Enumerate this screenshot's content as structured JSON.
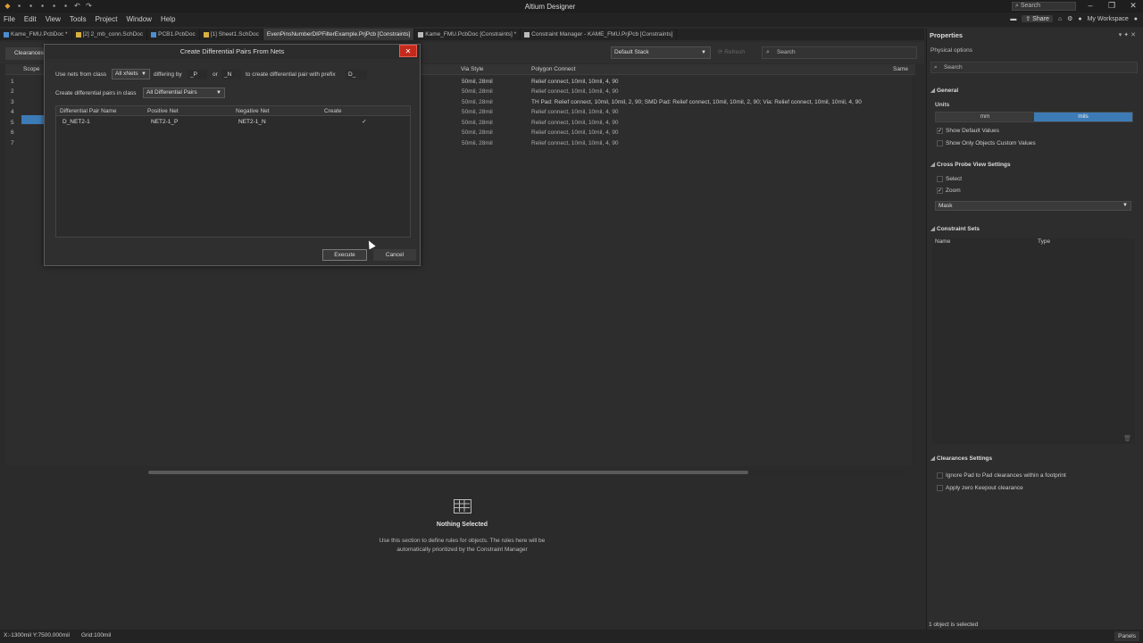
{
  "app": {
    "title": "Altium Designer"
  },
  "titlebar": {
    "search_placeholder": "Search"
  },
  "menu": {
    "items": [
      "File",
      "Edit",
      "View",
      "Tools",
      "Project",
      "Window",
      "Help"
    ],
    "share_label": "Share",
    "workspace_label": "My Workspace"
  },
  "tabs": [
    {
      "label": "Kame_FMU.PcbDoc *"
    },
    {
      "label": "[2] 2_mb_conn.SchDoc"
    },
    {
      "label": "PCB1.PcbDoc"
    },
    {
      "label": "[1] Sheet1.SchDoc"
    },
    {
      "label": "EvenPinsNumberDIPFilterExample.PrjPcb [Constraints]"
    },
    {
      "label": "Kame_FMU.PcbDoc [Constraints] *"
    },
    {
      "label": "Constraint Manager - KAME_FMU.PrjPcb [Constraints]"
    }
  ],
  "toolbar": {
    "clearance_tab": "Clearances",
    "stack_value": "Default Stack",
    "refresh_label": "Refresh",
    "search_placeholder": "Search"
  },
  "grid": {
    "headers": {
      "scope": "Scope",
      "via_style": "Via Style",
      "polygon_connect": "Polygon Connect",
      "same": "Same"
    },
    "row_numbers": [
      "1",
      "2",
      "3",
      "4",
      "5",
      "6",
      "7"
    ],
    "rows": [
      {
        "via": "50mil, 28mil",
        "polygon": "Relief connect, 10mil, 10mil, 4, 90"
      },
      {
        "via": "50mil, 28mil",
        "polygon": "Relief connect, 10mil, 10mil, 4, 90"
      },
      {
        "via": "50mil, 28mil",
        "polygon": "TH Pad: Relief connect, 10mil, 10mil, 2, 90; SMD Pad: Relief connect, 10mil, 10mil, 2, 90; Via: Relief connect, 10mil, 10mil, 4, 90"
      },
      {
        "via": "50mil, 28mil",
        "polygon": "Relief connect, 10mil, 10mil, 4, 90"
      },
      {
        "via": "50mil, 28mil",
        "polygon": "Relief connect, 10mil, 10mil, 4, 90"
      },
      {
        "via": "50mil, 28mil",
        "polygon": "Relief connect, 10mil, 10mil, 4, 90"
      },
      {
        "via": "50mil, 28mil",
        "polygon": "Relief connect, 10mil, 10mil, 4, 90"
      }
    ]
  },
  "nothing_selected": {
    "title": "Nothing Selected",
    "desc": "Use this section to define rules for objects. The rules here will be automatically prioritized by the Constraint Manager"
  },
  "dialog": {
    "title": "Create Differential Pairs From Nets",
    "use_nets_label": "Use nets from class",
    "class_value": "All xNets",
    "differing_by": "differing by",
    "pos_suffix": "_P",
    "or_label": "or",
    "neg_suffix": "_N",
    "prefix_label": "to create differential pair with prefix",
    "prefix_value": "D_",
    "create_in_label": "Create differential pairs in class",
    "create_in_value": "All Differential Pairs",
    "columns": {
      "name": "Differential Pair Name",
      "positive": "Positive Net",
      "negative": "Negative Net",
      "create": "Create"
    },
    "row": {
      "name": "D_NET2-1",
      "positive": "NET2-1_P",
      "negative": "NET2-1_N",
      "create": "✓"
    },
    "execute_label": "Execute",
    "cancel_label": "Cancel"
  },
  "properties": {
    "title": "Properties",
    "subtitle": "Physical options",
    "search_placeholder": "Search",
    "general": "General",
    "units_label": "Units",
    "unit_mm": "mm",
    "unit_mils": "mils",
    "show_default": "Show Default Values",
    "show_custom": "Show Only Objects Custom Values",
    "cross_probe": "Cross Probe View Settings",
    "select_label": "Select",
    "zoom_label": "Zoom",
    "mask_value": "Mask",
    "constraint_sets": "Constraint Sets",
    "cs_name": "Name",
    "cs_type": "Type",
    "clearances_settings": "Clearances Settings",
    "ignore_pad": "Ignore Pad to Pad clearances within a footprint",
    "apply_zero": "Apply zero Keepout clearance"
  },
  "status": {
    "coords": "X:-1300mil Y:7500.000mil",
    "grid": "Grid:100mil",
    "selection": "1 object is selected",
    "panels": "Panels"
  }
}
